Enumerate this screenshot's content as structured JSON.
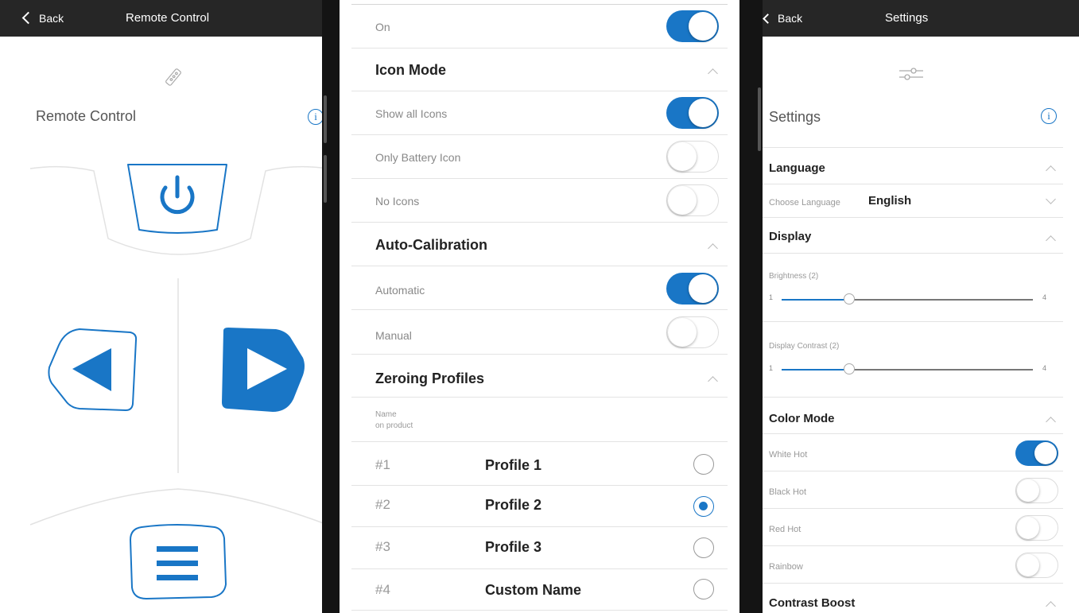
{
  "left": {
    "back_label": "Back",
    "title": "Remote Control",
    "section_label": "Remote Control",
    "icons": [
      "remote-icon",
      "info-icon",
      "power-icon",
      "left-arrow-icon",
      "right-arrow-icon",
      "menu-icon"
    ]
  },
  "middle": {
    "top_row": {
      "label": "On",
      "state": "on"
    },
    "icon_mode": {
      "title": "Icon Mode",
      "options": [
        {
          "label": "Show all Icons",
          "state": "on"
        },
        {
          "label": "Only Battery Icon",
          "state": "off"
        },
        {
          "label": "No Icons",
          "state": "off"
        }
      ]
    },
    "auto_calibration": {
      "title": "Auto-Calibration",
      "options": [
        {
          "label": "Automatic",
          "state": "on"
        },
        {
          "label": "Manual",
          "state": "off"
        }
      ]
    },
    "zeroing_profiles": {
      "title": "Zeroing Profiles",
      "column_header_line1": "Name",
      "column_header_line2": "on product",
      "profiles": [
        {
          "number": "#1",
          "name": "Profile 1",
          "selected": false
        },
        {
          "number": "#2",
          "name": "Profile 2",
          "selected": true
        },
        {
          "number": "#3",
          "name": "Profile 3",
          "selected": false
        },
        {
          "number": "#4",
          "name": "Custom Name",
          "selected": false
        }
      ]
    }
  },
  "right": {
    "back_label": "Back",
    "title": "Settings",
    "section_label": "Settings",
    "language": {
      "title": "Language",
      "choose_label": "Choose Language",
      "value": "English"
    },
    "display": {
      "title": "Display",
      "brightness": {
        "label": "Brightness (2)",
        "min": "1",
        "max": "4",
        "value": 2
      },
      "contrast": {
        "label": "Display Contrast (2)",
        "min": "1",
        "max": "4",
        "value": 2
      }
    },
    "color_mode": {
      "title": "Color Mode",
      "options": [
        {
          "label": "White Hot",
          "state": "on"
        },
        {
          "label": "Black Hot",
          "state": "off"
        },
        {
          "label": "Red Hot",
          "state": "off"
        },
        {
          "label": "Rainbow",
          "state": "off"
        }
      ]
    },
    "contrast_boost": {
      "title": "Contrast Boost"
    }
  },
  "colors": {
    "accent": "#1976c6",
    "topbar": "#262626",
    "frame": "#141414"
  }
}
